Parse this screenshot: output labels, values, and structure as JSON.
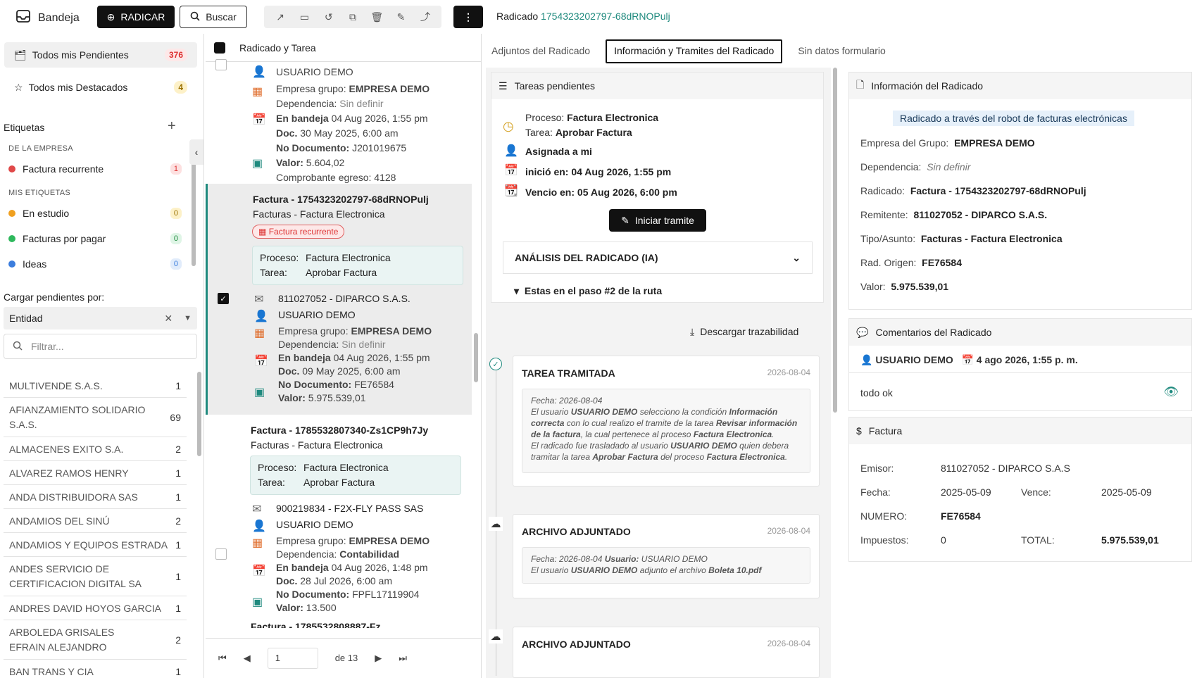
{
  "app": {
    "title": "Bandeja",
    "radicar": "RADICAR",
    "buscar": "Buscar",
    "more": "⋮",
    "radicado_label": "Radicado",
    "radicado_id": "1754323202797-68dRNOPulj"
  },
  "sidebar": {
    "items": [
      {
        "label": "Todos mis Pendientes",
        "count": "376"
      },
      {
        "label": "Todos mis Destacados",
        "count": "4"
      }
    ],
    "etiquetas_title": "Etiquetas",
    "empresa_title": "DE LA EMPRESA",
    "mis_title": "MIS ETIQUETAS",
    "tags": [
      {
        "label": "Factura recurrente",
        "count": "1",
        "color": "#e04848"
      },
      {
        "label": "En estudio",
        "count": "0",
        "color": "#f0a020"
      },
      {
        "label": "Facturas por pagar",
        "count": "0",
        "color": "#2eb85c"
      },
      {
        "label": "Ideas",
        "count": "0",
        "color": "#3b7ddd"
      }
    ],
    "cargar_label": "Cargar pendientes por:",
    "select_value": "Entidad",
    "filter_placeholder": "Filtrar...",
    "entities": [
      {
        "name": "MULTIVENDE S.A.S.",
        "n": "1"
      },
      {
        "name": "AFIANZAMIENTO SOLIDARIO S.A.S.",
        "n": "69"
      },
      {
        "name": "ALMACENES EXITO S.A.",
        "n": "2"
      },
      {
        "name": "ALVAREZ RAMOS HENRY",
        "n": "1"
      },
      {
        "name": "ANDA DISTRIBUIDORA SAS",
        "n": "1"
      },
      {
        "name": "ANDAMIOS DEL SINÚ",
        "n": "2"
      },
      {
        "name": "ANDAMIOS Y EQUIPOS ESTRADA",
        "n": "1"
      },
      {
        "name": "ANDES SERVICIO DE CERTIFICACION DIGITAL SA",
        "n": "1"
      },
      {
        "name": "ANDRES DAVID HOYOS GARCIA",
        "n": "1"
      },
      {
        "name": "ARBOLEDA GRISALES EFRAIN ALEJANDRO",
        "n": "2"
      },
      {
        "name": "BAN TRANS Y CIA",
        "n": "1"
      }
    ]
  },
  "list": {
    "header": "Radicado y Tarea",
    "card0": {
      "user": "USUARIO DEMO",
      "empresa_l": "Empresa grupo:",
      "empresa": "EMPRESA DEMO",
      "dep_l": "Dependencia:",
      "dep": "Sin definir",
      "bandeja_l": "En bandeja",
      "bandeja": "04 Aug 2026, 1:55 pm",
      "doc_l": "Doc.",
      "doc": "30 May 2025, 6:00 am",
      "nodoc_l": "No Documento:",
      "nodoc": "J201019675",
      "valor_l": "Valor:",
      "valor": "5.604,02",
      "comp": "Comprobante egreso: 4128"
    },
    "card1": {
      "title": "Factura - 1754323202797-68dRNOPulj",
      "sub": "Facturas - Factura Electronica",
      "badge": "Factura recurrente",
      "proc_l": "Proceso:",
      "proc": "Factura Electronica",
      "tarea_l": "Tarea:",
      "tarea": "Aprobar Factura",
      "remit": "811027052 - DIPARCO S.A.S.",
      "user": "USUARIO DEMO",
      "empresa": "EMPRESA DEMO",
      "dep": "Sin definir",
      "bandeja": "04 Aug 2026, 1:55 pm",
      "doc": "09 May 2025, 6:00 am",
      "nodoc": "FE76584",
      "valor": "5.975.539,01"
    },
    "card2": {
      "title": "Factura - 1785532807340-Zs1CP9h7Jy",
      "sub": "Facturas - Factura Electronica",
      "proc": "Factura Electronica",
      "tarea": "Aprobar Factura",
      "remit": "900219834 - F2X-FLY PASS SAS",
      "user": "USUARIO DEMO",
      "empresa": "EMPRESA DEMO",
      "dep": "Contabilidad",
      "bandeja": "04 Aug 2026, 1:48 pm",
      "doc": "28 Jul 2026, 6:00 am",
      "nodoc": "FPFL17119904",
      "valor": "13.500"
    },
    "card3_title": "Factura - 1785532808887-Fz...",
    "pager": {
      "page": "1",
      "of": "de 13"
    }
  },
  "tabs": [
    "Adjuntos del Radicado",
    "Información y Tramites del Radicado",
    "Sin datos formulario"
  ],
  "tareas": {
    "title": "Tareas pendientes",
    "proceso_l": "Proceso:",
    "proceso": "Factura Electronica",
    "tarea_l": "Tarea:",
    "tarea": "Aprobar Factura",
    "asignada": "Asignada a mi",
    "inicio": "inició en: 04 Aug 2026, 1:55 pm",
    "vence": "Vencio en: 05 Aug 2026, 6:00 pm",
    "iniciar": "Iniciar tramite",
    "analisis": "ANÁLISIS DEL RADICADO (IA)",
    "paso": "Estas en el paso #2 de la ruta"
  },
  "traza": {
    "descargar": "Descargar trazabilidad",
    "events": [
      {
        "title": "TAREA TRAMITADA",
        "date": "2026-08-04"
      },
      {
        "title": "ARCHIVO ADJUNTADO",
        "date": "2026-08-04",
        "fecha": "Fecha: 2026-08-04",
        "usuario_l": "Usuario:",
        "usuario": "USUARIO DEMO",
        "text_a": "El usuario",
        "text_b": "adjunto el archivo",
        "archivo": "Boleta 10.pdf"
      },
      {
        "title": "ARCHIVO ADJUNTADO",
        "date": "2026-08-04"
      }
    ],
    "ev0": {
      "fecha": "Fecha: 2026-08-04",
      "t1": "El usuario",
      "user": "USUARIO DEMO",
      "t2": "selecciono la condición",
      "cond": "Información correcta",
      "t3": "con lo cual realizo el tramite de la tarea",
      "tarea": "Revisar información de la factura",
      "t4": ", la cual pertenece al proceso",
      "proc": "Factura Electronica",
      "t5": "El radicado fue trasladado al usuario",
      "t6": "quien debera tramitar la tarea",
      "tarea2": "Aprobar Factura",
      "t7": "del proceso"
    }
  },
  "info": {
    "title": "Información del Radicado",
    "robot": "Radicado a través del robot de facturas electrónicas",
    "rows": [
      {
        "l": "Empresa del Grupo:",
        "v": "EMPRESA DEMO"
      },
      {
        "l": "Dependencia:",
        "v": "Sin definir"
      },
      {
        "l": "Radicado:",
        "v": "Factura - 1754323202797-68dRNOPulj"
      },
      {
        "l": "Remitente:",
        "v": "811027052 - DIPARCO S.A.S."
      },
      {
        "l": "Tipo/Asunto:",
        "v": "Facturas - Factura Electronica"
      },
      {
        "l": "Rad. Origen:",
        "v": "FE76584"
      },
      {
        "l": "Valor:",
        "v": "5.975.539,01"
      }
    ]
  },
  "comentarios": {
    "title": "Comentarios del Radicado",
    "user": "USUARIO DEMO",
    "date": "4 ago 2026, 1:55 p. m.",
    "text": "todo ok"
  },
  "factura": {
    "title": "Factura",
    "emisor_l": "Emisor:",
    "emisor": "811027052 - DIPARCO S.A.S",
    "fecha_l": "Fecha:",
    "fecha": "2025-05-09",
    "vence_l": "Vence:",
    "vence": "2025-05-09",
    "numero_l": "NUMERO:",
    "numero": "FE76584",
    "imp_l": "Impuestos:",
    "imp": "0",
    "total_l": "TOTAL:",
    "total": "5.975.539,01"
  }
}
